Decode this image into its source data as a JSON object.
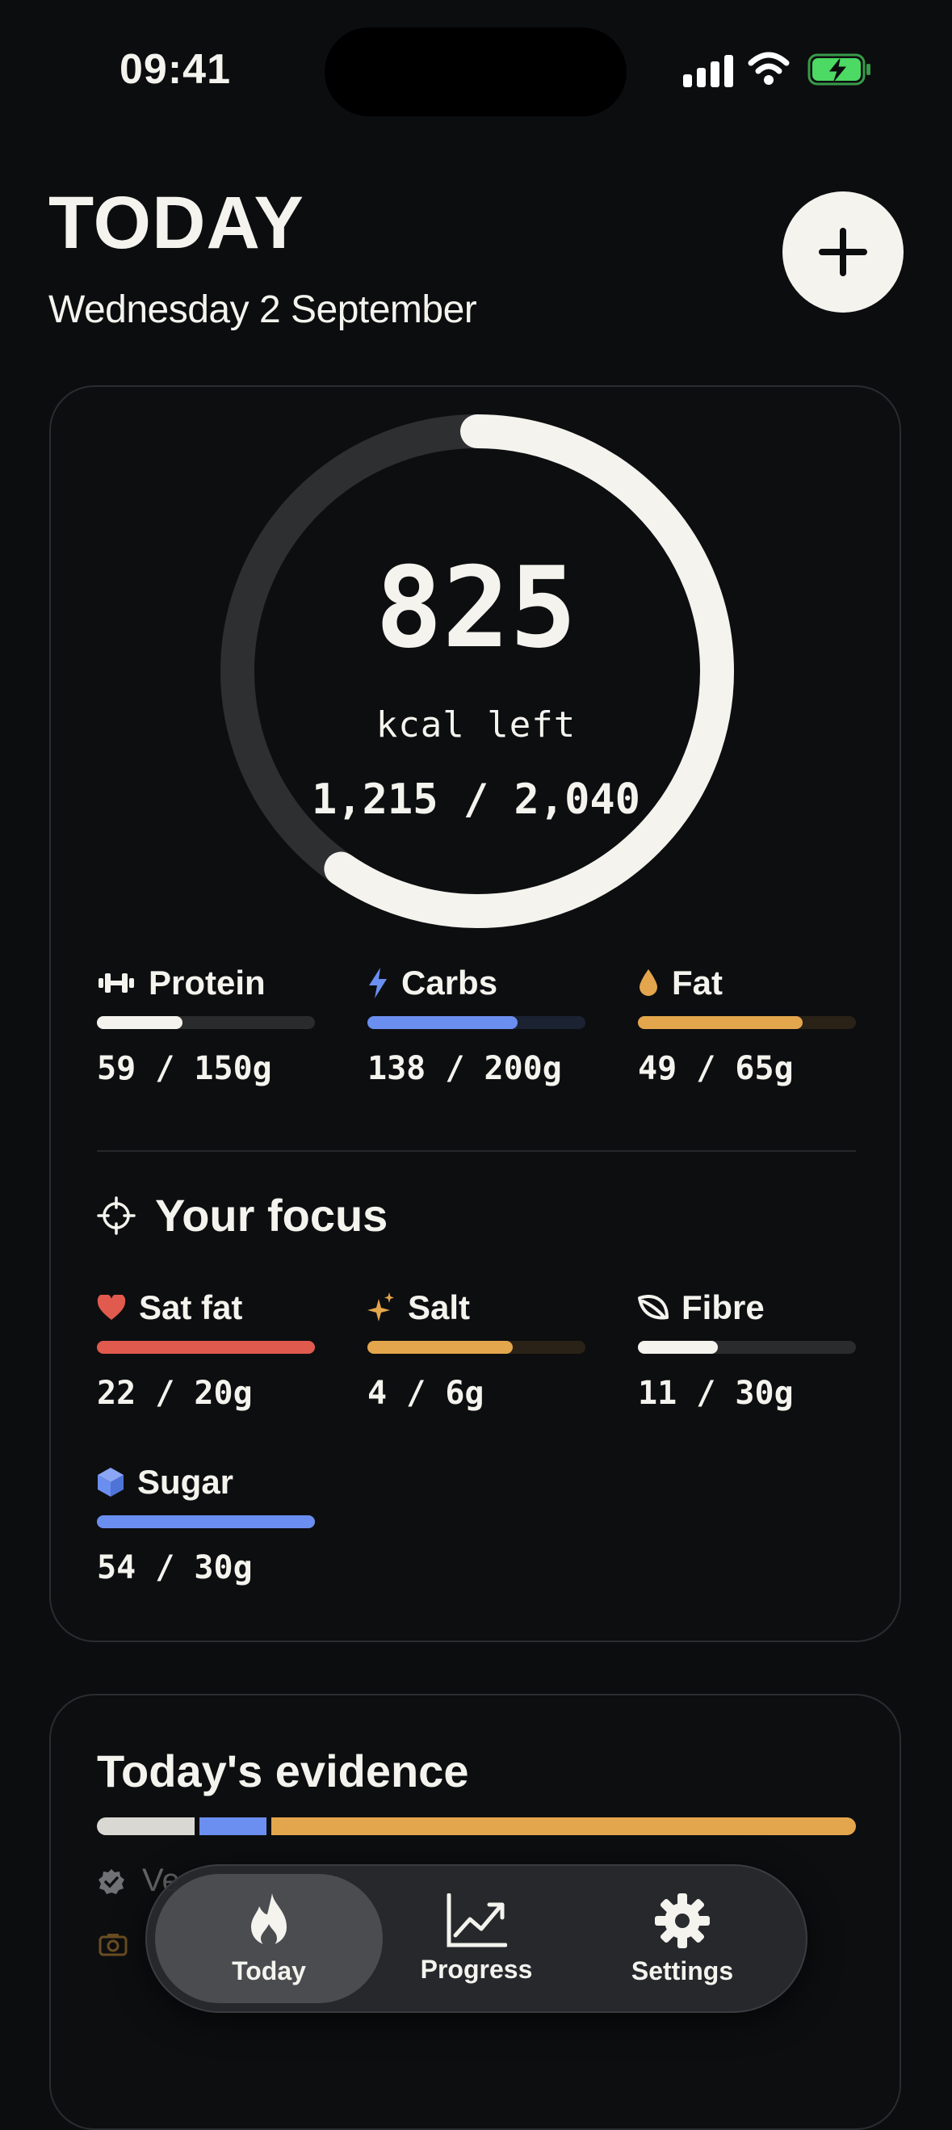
{
  "status_bar": {
    "time": "09:41"
  },
  "header": {
    "title": "TODAY",
    "date": "Wednesday 2 September",
    "add_icon": "plus-icon"
  },
  "calories": {
    "remaining": "825",
    "remaining_label": "kcal left",
    "consumed_of_goal": "1,215 / 2,040",
    "progress_fraction": 0.596
  },
  "macros": [
    {
      "label": "Protein",
      "value": "59 / 150g",
      "icon": "dumbbell-icon",
      "color": "#f4f3ee",
      "track": "#2a2b2d",
      "fraction": 0.393
    },
    {
      "label": "Carbs",
      "value": "138 / 200g",
      "icon": "bolt-icon",
      "color": "#6b8ff0",
      "track": "#1b2232",
      "fraction": 0.69
    },
    {
      "label": "Fat",
      "value": "49 / 65g",
      "icon": "drop-icon",
      "color": "#e4a64c",
      "track": "#2a2217",
      "fraction": 0.754
    }
  ],
  "focus": {
    "title": "Your focus",
    "icon": "crosshair-icon",
    "items": [
      {
        "label": "Sat fat",
        "value": "22 / 20g",
        "icon": "heart-icon",
        "color": "#e05a4e",
        "track": "#2a1a18",
        "fraction": 1.0
      },
      {
        "label": "Salt",
        "value": "4 / 6g",
        "icon": "sparkle-icon",
        "color": "#e4a64c",
        "track": "#2a2217",
        "fraction": 0.667
      },
      {
        "label": "Fibre",
        "value": "11 / 30g",
        "icon": "leaf-icon",
        "color": "#f4f3ee",
        "track": "#2a2b2d",
        "fraction": 0.367
      },
      {
        "label": "Sugar",
        "value": "54 / 30g",
        "icon": "cube-icon",
        "color": "#6b8ff0",
        "track": "#1b2232",
        "fraction": 1.0
      }
    ]
  },
  "evidence": {
    "title": "Today's evidence",
    "segments": [
      {
        "color": "#d9d8d2",
        "fraction": 0.13
      },
      {
        "color": "#6b8ff0",
        "fraction": 0.09
      },
      {
        "color": "#e4a64c",
        "fraction": 0.78
      }
    ],
    "row1_text": "Ve"
  },
  "tabs": [
    {
      "label": "Today",
      "icon": "flame-icon",
      "active": true
    },
    {
      "label": "Progress",
      "icon": "chart-trend-icon",
      "active": false
    },
    {
      "label": "Settings",
      "icon": "gear-icon",
      "active": false
    }
  ]
}
